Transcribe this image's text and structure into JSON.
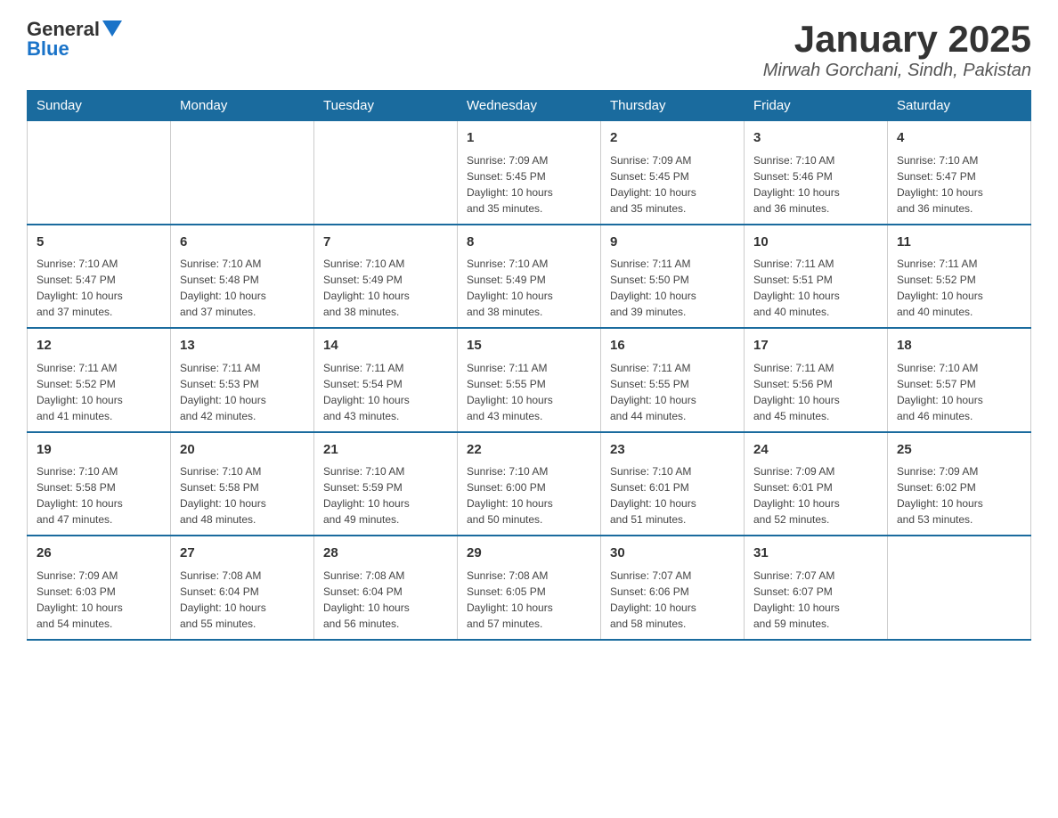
{
  "header": {
    "logo_general": "General",
    "logo_blue": "Blue",
    "title": "January 2025",
    "subtitle": "Mirwah Gorchani, Sindh, Pakistan"
  },
  "days_of_week": [
    "Sunday",
    "Monday",
    "Tuesday",
    "Wednesday",
    "Thursday",
    "Friday",
    "Saturday"
  ],
  "weeks": [
    [
      {
        "day": "",
        "info": ""
      },
      {
        "day": "",
        "info": ""
      },
      {
        "day": "",
        "info": ""
      },
      {
        "day": "1",
        "info": "Sunrise: 7:09 AM\nSunset: 5:45 PM\nDaylight: 10 hours\nand 35 minutes."
      },
      {
        "day": "2",
        "info": "Sunrise: 7:09 AM\nSunset: 5:45 PM\nDaylight: 10 hours\nand 35 minutes."
      },
      {
        "day": "3",
        "info": "Sunrise: 7:10 AM\nSunset: 5:46 PM\nDaylight: 10 hours\nand 36 minutes."
      },
      {
        "day": "4",
        "info": "Sunrise: 7:10 AM\nSunset: 5:47 PM\nDaylight: 10 hours\nand 36 minutes."
      }
    ],
    [
      {
        "day": "5",
        "info": "Sunrise: 7:10 AM\nSunset: 5:47 PM\nDaylight: 10 hours\nand 37 minutes."
      },
      {
        "day": "6",
        "info": "Sunrise: 7:10 AM\nSunset: 5:48 PM\nDaylight: 10 hours\nand 37 minutes."
      },
      {
        "day": "7",
        "info": "Sunrise: 7:10 AM\nSunset: 5:49 PM\nDaylight: 10 hours\nand 38 minutes."
      },
      {
        "day": "8",
        "info": "Sunrise: 7:10 AM\nSunset: 5:49 PM\nDaylight: 10 hours\nand 38 minutes."
      },
      {
        "day": "9",
        "info": "Sunrise: 7:11 AM\nSunset: 5:50 PM\nDaylight: 10 hours\nand 39 minutes."
      },
      {
        "day": "10",
        "info": "Sunrise: 7:11 AM\nSunset: 5:51 PM\nDaylight: 10 hours\nand 40 minutes."
      },
      {
        "day": "11",
        "info": "Sunrise: 7:11 AM\nSunset: 5:52 PM\nDaylight: 10 hours\nand 40 minutes."
      }
    ],
    [
      {
        "day": "12",
        "info": "Sunrise: 7:11 AM\nSunset: 5:52 PM\nDaylight: 10 hours\nand 41 minutes."
      },
      {
        "day": "13",
        "info": "Sunrise: 7:11 AM\nSunset: 5:53 PM\nDaylight: 10 hours\nand 42 minutes."
      },
      {
        "day": "14",
        "info": "Sunrise: 7:11 AM\nSunset: 5:54 PM\nDaylight: 10 hours\nand 43 minutes."
      },
      {
        "day": "15",
        "info": "Sunrise: 7:11 AM\nSunset: 5:55 PM\nDaylight: 10 hours\nand 43 minutes."
      },
      {
        "day": "16",
        "info": "Sunrise: 7:11 AM\nSunset: 5:55 PM\nDaylight: 10 hours\nand 44 minutes."
      },
      {
        "day": "17",
        "info": "Sunrise: 7:11 AM\nSunset: 5:56 PM\nDaylight: 10 hours\nand 45 minutes."
      },
      {
        "day": "18",
        "info": "Sunrise: 7:10 AM\nSunset: 5:57 PM\nDaylight: 10 hours\nand 46 minutes."
      }
    ],
    [
      {
        "day": "19",
        "info": "Sunrise: 7:10 AM\nSunset: 5:58 PM\nDaylight: 10 hours\nand 47 minutes."
      },
      {
        "day": "20",
        "info": "Sunrise: 7:10 AM\nSunset: 5:58 PM\nDaylight: 10 hours\nand 48 minutes."
      },
      {
        "day": "21",
        "info": "Sunrise: 7:10 AM\nSunset: 5:59 PM\nDaylight: 10 hours\nand 49 minutes."
      },
      {
        "day": "22",
        "info": "Sunrise: 7:10 AM\nSunset: 6:00 PM\nDaylight: 10 hours\nand 50 minutes."
      },
      {
        "day": "23",
        "info": "Sunrise: 7:10 AM\nSunset: 6:01 PM\nDaylight: 10 hours\nand 51 minutes."
      },
      {
        "day": "24",
        "info": "Sunrise: 7:09 AM\nSunset: 6:01 PM\nDaylight: 10 hours\nand 52 minutes."
      },
      {
        "day": "25",
        "info": "Sunrise: 7:09 AM\nSunset: 6:02 PM\nDaylight: 10 hours\nand 53 minutes."
      }
    ],
    [
      {
        "day": "26",
        "info": "Sunrise: 7:09 AM\nSunset: 6:03 PM\nDaylight: 10 hours\nand 54 minutes."
      },
      {
        "day": "27",
        "info": "Sunrise: 7:08 AM\nSunset: 6:04 PM\nDaylight: 10 hours\nand 55 minutes."
      },
      {
        "day": "28",
        "info": "Sunrise: 7:08 AM\nSunset: 6:04 PM\nDaylight: 10 hours\nand 56 minutes."
      },
      {
        "day": "29",
        "info": "Sunrise: 7:08 AM\nSunset: 6:05 PM\nDaylight: 10 hours\nand 57 minutes."
      },
      {
        "day": "30",
        "info": "Sunrise: 7:07 AM\nSunset: 6:06 PM\nDaylight: 10 hours\nand 58 minutes."
      },
      {
        "day": "31",
        "info": "Sunrise: 7:07 AM\nSunset: 6:07 PM\nDaylight: 10 hours\nand 59 minutes."
      },
      {
        "day": "",
        "info": ""
      }
    ]
  ]
}
